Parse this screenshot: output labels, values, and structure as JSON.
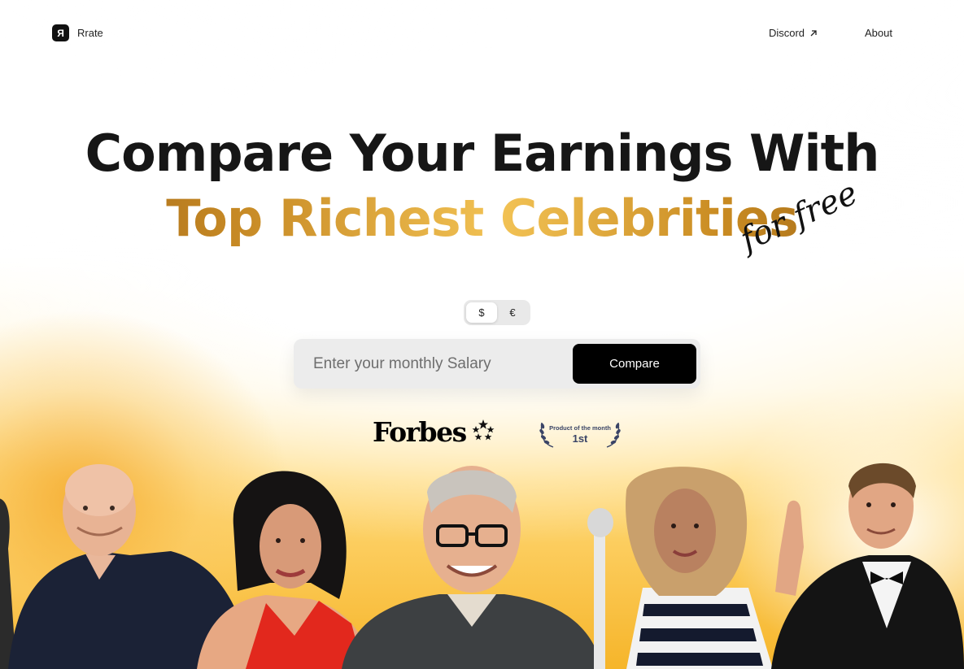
{
  "header": {
    "logo_mark": "Я",
    "logo_text": "Rrate",
    "nav": [
      {
        "label": "Discord",
        "icon": "external-arrow-icon"
      },
      {
        "label": "About"
      }
    ]
  },
  "hero": {
    "line1": "Compare Your Earnings With",
    "line2": "Top Richest Celebrities",
    "handwritten": "for free"
  },
  "currency": {
    "options": [
      "$",
      "€"
    ],
    "selected": "$"
  },
  "salary_form": {
    "placeholder": "Enter your monthly Salary",
    "button": "Compare"
  },
  "badges": {
    "forbes": "Forbes",
    "award_title": "Product of the month",
    "award_rank": "1st"
  },
  "colors": {
    "gold_dark": "#9a5f14",
    "gold_light": "#f2c254",
    "button": "#000000",
    "background_glow": "#f6b52a"
  }
}
